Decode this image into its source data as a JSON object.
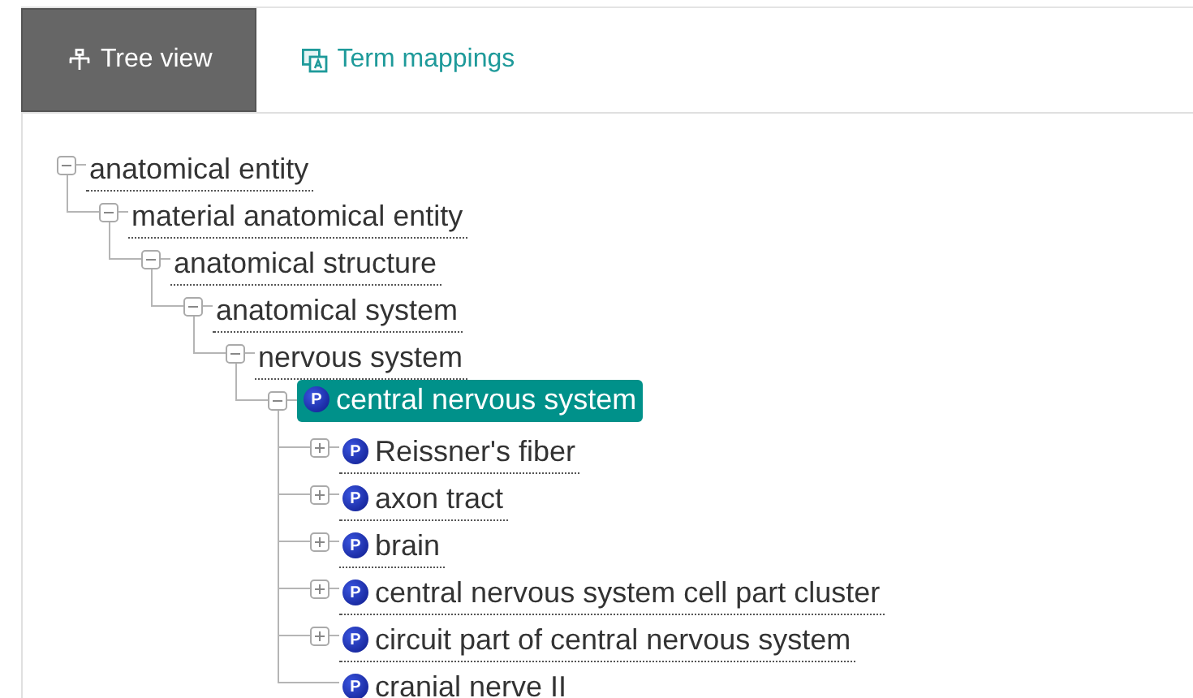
{
  "tabs": [
    {
      "label": "Tree view",
      "selected": true
    },
    {
      "label": "Term mappings",
      "selected": false
    }
  ],
  "tree": [
    {
      "label": "anatomical entity",
      "kind": "branch",
      "expanded": true,
      "property": false,
      "selected": false,
      "children": [
        {
          "label": "material anatomical entity",
          "kind": "branch",
          "expanded": true,
          "property": false,
          "selected": false,
          "children": [
            {
              "label": "anatomical structure",
              "kind": "branch",
              "expanded": true,
              "property": false,
              "selected": false,
              "children": [
                {
                  "label": "anatomical system",
                  "kind": "branch",
                  "expanded": true,
                  "property": false,
                  "selected": false,
                  "children": [
                    {
                      "label": "nervous system",
                      "kind": "branch",
                      "expanded": true,
                      "property": false,
                      "selected": false,
                      "children": [
                        {
                          "label": "central nervous system",
                          "kind": "branch",
                          "expanded": true,
                          "property": true,
                          "badge": "P",
                          "selected": true,
                          "children": [
                            {
                              "label": "Reissner's fiber",
                              "kind": "branch",
                              "expanded": false,
                              "property": true,
                              "badge": "P",
                              "selected": false
                            },
                            {
                              "label": "axon tract",
                              "kind": "branch",
                              "expanded": false,
                              "property": true,
                              "badge": "P",
                              "selected": false
                            },
                            {
                              "label": "brain",
                              "kind": "branch",
                              "expanded": false,
                              "property": true,
                              "badge": "P",
                              "selected": false
                            },
                            {
                              "label": "central nervous system cell part cluster",
                              "kind": "branch",
                              "expanded": false,
                              "property": true,
                              "badge": "P",
                              "selected": false
                            },
                            {
                              "label": "circuit part of central nervous system",
                              "kind": "branch",
                              "expanded": false,
                              "property": true,
                              "badge": "P",
                              "selected": false
                            },
                            {
                              "label": "cranial nerve II",
                              "kind": "leaf",
                              "property": true,
                              "badge": "P",
                              "selected": false
                            }
                          ]
                        }
                      ]
                    }
                  ]
                }
              ]
            }
          ]
        }
      ]
    }
  ]
}
